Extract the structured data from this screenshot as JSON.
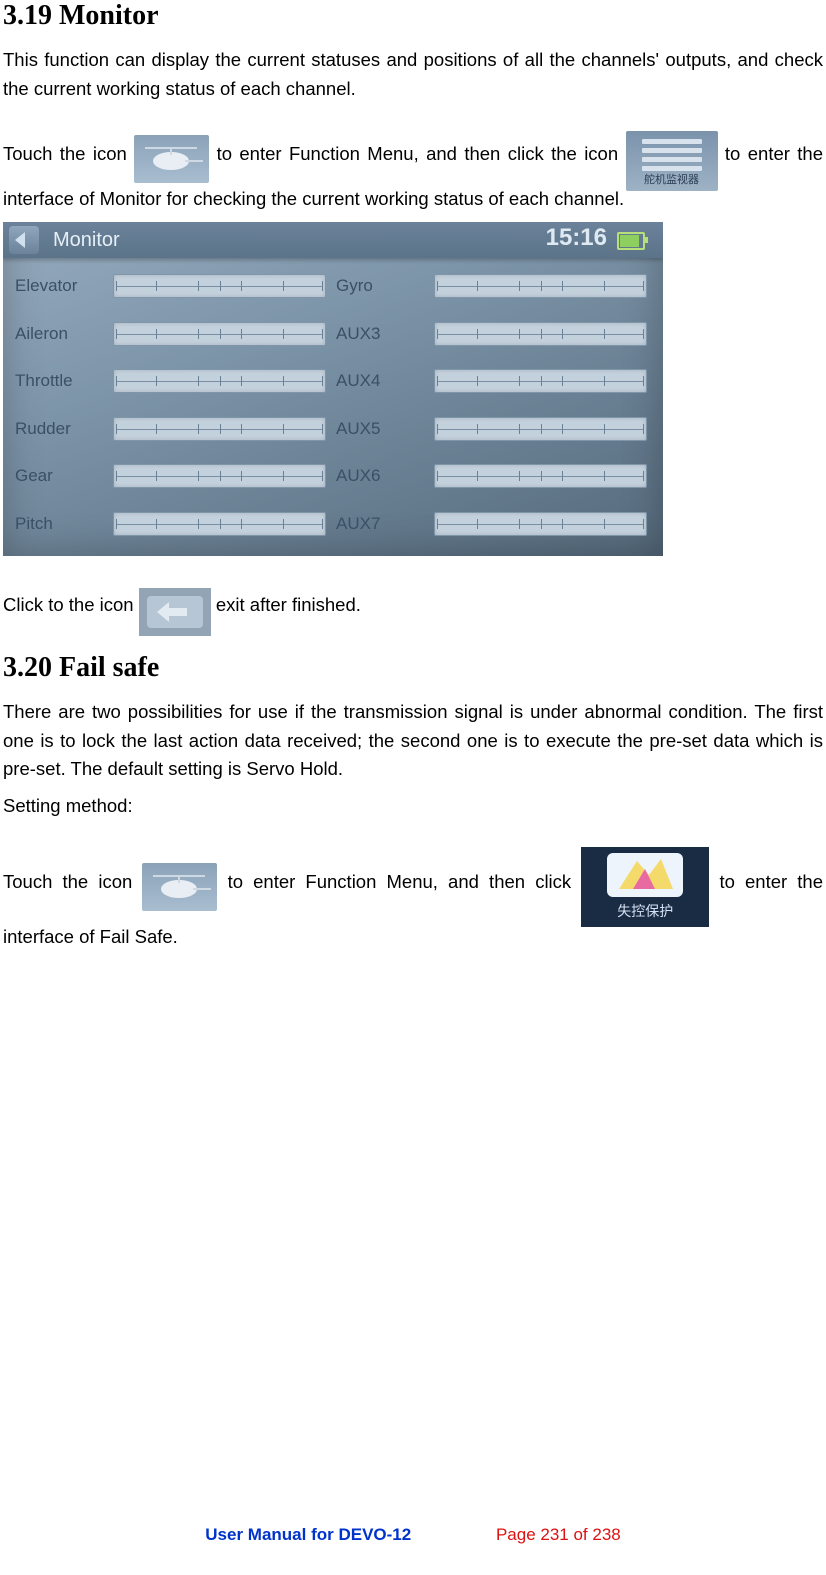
{
  "section1": {
    "heading": "3.19 Monitor",
    "p1": "This function can display the current statuses and positions of all the channels' outputs, and check the current working status of each channel.",
    "p2a": "Touch the icon ",
    "p2b": " to enter Function Menu, and then click the icon ",
    "p2c": " to enter the interface of Monitor for checking the current working status of each channel.",
    "p3a": "Click to the icon ",
    "p3b": " exit after finished."
  },
  "section2": {
    "heading": "3.20 Fail safe",
    "p1": "There are two possibilities for use if the transmission signal is under abnormal condition. The first one is to lock the last action data received; the second one is to execute the pre-set data which is pre-set. The default setting is Servo Hold.",
    "p2": "Setting method:",
    "p3a": "Touch the icon ",
    "p3b": " to enter Function Menu, and then click ",
    "p3c": " to enter the interface of Fail Safe."
  },
  "screenshot": {
    "title": "Monitor",
    "clock": "15:16",
    "left_labels": [
      "Elevator",
      "Aileron",
      "Throttle",
      "Rudder",
      "Gear",
      "Pitch"
    ],
    "right_labels": [
      "Gyro",
      "AUX3",
      "AUX4",
      "AUX5",
      "AUX6",
      "AUX7"
    ]
  },
  "icons": {
    "monitor_caption": "舵机监视器",
    "failsafe_caption": "失控保护"
  },
  "footer": {
    "left": "User Manual for DEVO-12",
    "right": "Page 231 of 238"
  }
}
